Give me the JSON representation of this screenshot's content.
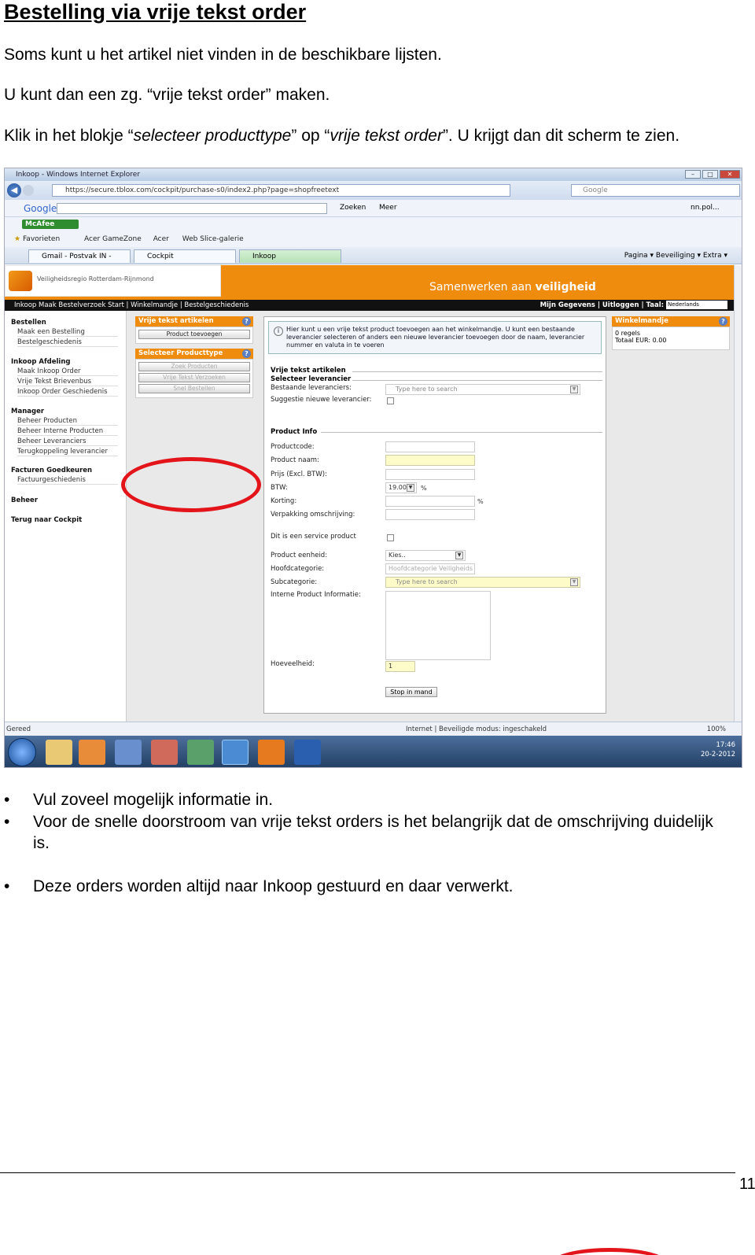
{
  "document": {
    "title": "Bestelling via vrije tekst order",
    "para1": "Soms kunt u het artikel niet vinden in de beschikbare lijsten.",
    "para2": "U kunt dan een zg. “vrije tekst order” maken.",
    "para3_a": "Klik in het blokje “",
    "para3_b": "selecteer producttype",
    "para3_c": "” op “",
    "para3_d": "vrije tekst order",
    "para3_e": "”. U krijgt dan dit scherm te zien.",
    "bullets": [
      "Vul zoveel mogelijk informatie in.",
      "Voor de snelle doorstroom van vrije tekst orders is het belangrijk dat de omschrijving duidelijk is.",
      "Deze orders worden altijd naar Inkoop gestuurd en daar verwerkt."
    ],
    "page_number": "11"
  },
  "browser": {
    "window_title": "Inkoop - Windows Internet Explorer",
    "url": "https://secure.tblox.com/cockpit/purchase-s0/index2.php?page=shopfreetext",
    "search_engine": "Google",
    "google_label": "Google",
    "zoeken": "Zoeken",
    "meer": "Meer",
    "user": "nn.pol...",
    "mcafee": "McAfee",
    "favorites": "Favorieten",
    "fav_items": [
      "Acer GameZone",
      "Acer",
      "Web Slice-galerie"
    ],
    "tabs": [
      "Gmail - Postvak IN - nn.po...",
      "Cockpit",
      "Inkoop"
    ],
    "commands": "Pagina ▾   Beveiliging ▾   Extra ▾",
    "status_left": "Gereed",
    "status_mid": "Internet | Beveiligde modus: ingeschakeld",
    "zoom": "100%",
    "clock_time": "17:46",
    "clock_date": "20-2-2012"
  },
  "site": {
    "logo_text": "Veiligheidsregio Rotterdam-Rijnmond",
    "slogan_pre": "Samenwerken aan ",
    "slogan_bold": "veiligheid",
    "breadcrumb": "Inkoop      Maak Bestelverzoek         Start | Winkelmandje | Bestelgeschiedenis",
    "top_right": "Mijn Gegevens | Uitloggen | Taal:",
    "language": "Nederlands",
    "menu": [
      {
        "head": "Bestellen",
        "items": [
          "Maak een Bestelling",
          "Bestelgeschiedenis"
        ]
      },
      {
        "head": "Inkoop Afdeling",
        "items": [
          "Maak Inkoop Order",
          "Vrije Tekst Brievenbus",
          "Inkoop Order Geschiedenis"
        ]
      },
      {
        "head": "Manager",
        "items": [
          "Beheer Producten",
          "Beheer Interne Producten",
          "Beheer Leveranciers",
          "Terugkoppeling leverancier"
        ]
      },
      {
        "head": "Facturen Goedkeuren",
        "items": [
          "Factuurgeschiedenis"
        ]
      },
      {
        "head": "Beheer",
        "items": []
      },
      {
        "head": "Terug naar Cockpit",
        "items": []
      }
    ],
    "box1_title": "Vrije tekst artikelen",
    "box1_button": "Product toevoegen",
    "box2_title": "Selecteer Producttype",
    "box2_buttons": [
      "Zoek Producten",
      "Vrije Tekst Verzoeken",
      "Snel Bestellen"
    ],
    "info_text": "Hier kunt u een vrije tekst product toevoegen aan het winkelmandje. U kunt een bestaande leverancier selecteren of anders een nieuwe leverancier toevoegen door de naam, leverancier nummer en valuta in te voeren",
    "sect1": "Vrije tekst artikelen",
    "sect1_sub": "Selecteer leverancier",
    "bestaande": "Bestaande leveranciers:",
    "suggestie": "Suggestie nieuwe leverancier:",
    "search_placeholder": "Type here to search",
    "sect2": "Product Info",
    "f_productcode": "Productcode:",
    "f_productnaam": "Product naam:",
    "f_prijs": "Prijs (Excl. BTW):",
    "f_btw": "BTW:",
    "btw_value": "19.00",
    "f_korting": "Korting:",
    "f_verpakking": "Verpakking omschrijving:",
    "f_service": "Dit is een service product",
    "f_eenheid": "Product eenheid:",
    "eenheid_value": "Kies..",
    "f_hoofd": "Hoofdcategorie:",
    "hoofd_placeholder": "Hoofdcategorie Veiligheids",
    "f_sub": "Subcategorie:",
    "f_interne": "Interne Product Informatie:",
    "f_hoeveelheid": "Hoeveelheid:",
    "hoeveelheid_value": "1",
    "submit": "Stop in mand",
    "pct": "%",
    "cart_title": "Winkelmandje",
    "cart_regels": "0 regels",
    "cart_totaal": "Totaal EUR: 0.00"
  },
  "colors": {
    "accent": "#ef8c0e",
    "annotation": "#e3141a"
  }
}
